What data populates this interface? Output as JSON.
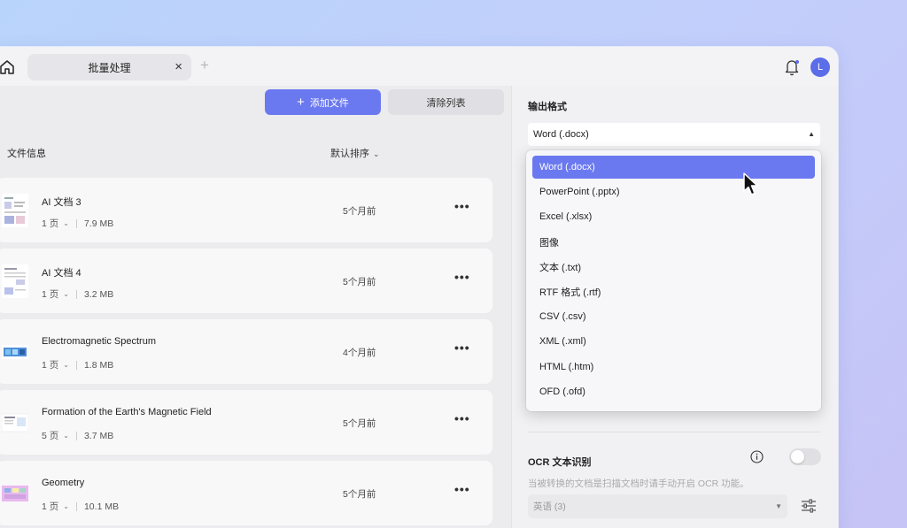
{
  "window": {
    "tab_title": "批量处理",
    "tab_close": "×",
    "tab_add": "+",
    "avatar_initial": "L"
  },
  "toolbar": {
    "add_files_label": "添加文件",
    "clear_list_label": "清除列表"
  },
  "file_list": {
    "header_title": "文件信息",
    "sort_label": "默认排序",
    "more_glyph": "•••",
    "files": [
      {
        "name": "AI 文档 3",
        "pages": "1 页",
        "size": "7.9 MB",
        "time": "5个月前"
      },
      {
        "name": "AI 文档 4",
        "pages": "1 页",
        "size": "3.2 MB",
        "time": "5个月前"
      },
      {
        "name": "Electromagnetic Spectrum",
        "pages": "1 页",
        "size": "1.8 MB",
        "time": "4个月前"
      },
      {
        "name": "Formation of the Earth's Magnetic Field",
        "pages": "5 页",
        "size": "3.7 MB",
        "time": "5个月前"
      },
      {
        "name": "Geometry",
        "pages": "1 页",
        "size": "10.1 MB",
        "time": "5个月前"
      }
    ]
  },
  "output": {
    "label": "输出格式",
    "selected": "Word (.docx)",
    "options": [
      "Word (.docx)",
      "PowerPoint (.pptx)",
      "Excel (.xlsx)",
      "图像",
      "文本 (.txt)",
      "RTF 格式 (.rtf)",
      "CSV (.csv)",
      "XML (.xml)",
      "HTML (.htm)",
      "OFD (.ofd)"
    ]
  },
  "ocr": {
    "title": "OCR 文本识别",
    "description": "当被转换的文档是扫描文档时请手动开启 OCR 功能。",
    "language": "英语 (3)",
    "enabled": false
  },
  "colors": {
    "accent": "#6b79f0",
    "avatar": "#5b6de8"
  }
}
